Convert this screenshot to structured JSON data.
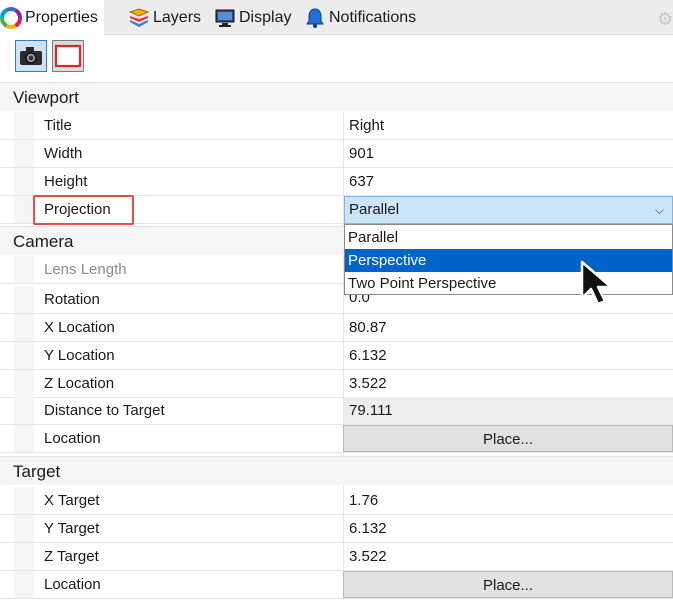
{
  "tabs": [
    {
      "label": "Properties",
      "icon": "color-wheel-icon",
      "active": true
    },
    {
      "label": "Layers",
      "icon": "layers-icon",
      "active": false
    },
    {
      "label": "Display",
      "icon": "display-monitor-icon",
      "active": false
    },
    {
      "label": "Notifications",
      "icon": "bell-icon",
      "active": false
    }
  ],
  "toolbar": {
    "buttons": [
      {
        "name": "camera-icon",
        "selected": true
      },
      {
        "name": "viewport-frame-icon",
        "selected": false
      }
    ]
  },
  "viewport": {
    "heading": "Viewport",
    "title_label": "Title",
    "title_value": "Right",
    "width_label": "Width",
    "width_value": "901",
    "height_label": "Height",
    "height_value": "637",
    "projection_label": "Projection",
    "projection_value": "Parallel",
    "projection_options": [
      "Parallel",
      "Perspective",
      "Two Point Perspective"
    ],
    "projection_highlighted": "Perspective"
  },
  "camera": {
    "heading": "Camera",
    "lens_label": "Lens Length",
    "rotation_label": "Rotation",
    "rotation_value": "0.0",
    "xloc_label": "X Location",
    "xloc_value": "80.87",
    "yloc_label": "Y Location",
    "yloc_value": "6.132",
    "zloc_label": "Z Location",
    "zloc_value": "3.522",
    "dist_label": "Distance to Target",
    "dist_value": "79.111",
    "location_label": "Location",
    "location_button": "Place..."
  },
  "target": {
    "heading": "Target",
    "xt_label": "X Target",
    "xt_value": "1.76",
    "yt_label": "Y Target",
    "yt_value": "6.132",
    "zt_label": "Z Target",
    "zt_value": "3.522",
    "location_label": "Location",
    "location_button": "Place..."
  },
  "colors": {
    "accent": "#0063c9",
    "selection": "#cce4f7",
    "highlight_box": "#e05050"
  }
}
